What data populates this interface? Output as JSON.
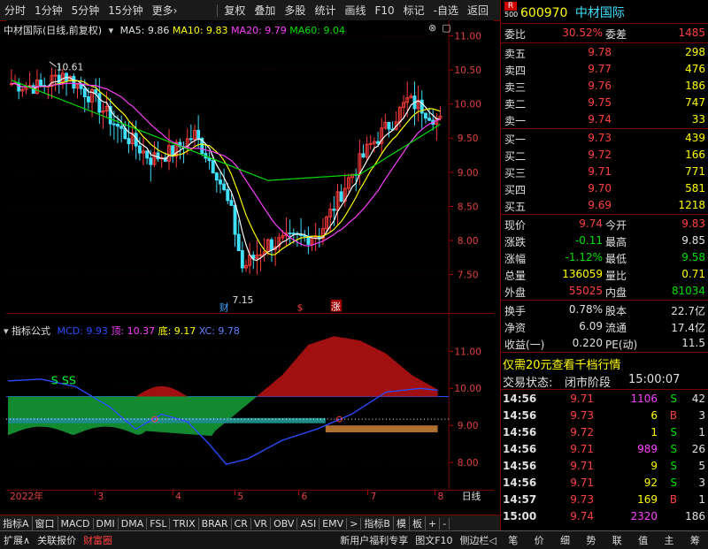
{
  "toolbar": {
    "periods": [
      "分时",
      "1分钟",
      "5分钟",
      "15分钟",
      "更多›"
    ],
    "actions": [
      "复权",
      "叠加",
      "多股",
      "统计",
      "画线",
      "F10",
      "标记",
      "-自选",
      "返回"
    ]
  },
  "main_legend": {
    "title": "中材国际(日线,前复权)",
    "ma5": "MA5: 9.86",
    "ma10": "MA10: 9.83",
    "ma20": "MA20: 9.79",
    "ma60": "MA60: 9.04"
  },
  "main_axis": [
    "11.00",
    "10.50",
    "10.00",
    "9.50",
    "9.00",
    "8.50",
    "8.00",
    "7.50"
  ],
  "annotations": {
    "high": "10.61",
    "low": "7.15",
    "cai": "财",
    "s1": "$",
    "zhang": "涨"
  },
  "indicator_legend": {
    "title": "指标公式",
    "mcd": "MCD: 9.93",
    "ding": "顶: 10.37",
    "di": "底: 9.17",
    "xc": "XC: 9.78",
    "ss": "S  SS"
  },
  "indicator_axis": [
    "11.00",
    "10.00",
    "9.00",
    "8.00"
  ],
  "x_axis": {
    "year": "2022年",
    "months": [
      "3",
      "4",
      "5",
      "6",
      "7",
      "8"
    ],
    "period_label": "日线"
  },
  "bottom_tabs": [
    "指标A",
    "窗口",
    "MACD",
    "DMI",
    "DMA",
    "FSL",
    "TRIX",
    "BRAR",
    "CR",
    "VR",
    "OBV",
    "ASI",
    "EMV",
    ">",
    "指标B",
    "模",
    "板",
    "+",
    "-"
  ],
  "status_bar": {
    "left": [
      "扩展∧",
      "关联报价",
      "财富圈"
    ],
    "promo": "新用户福利专享",
    "mid": [
      "图文F10",
      "侧边栏◁"
    ],
    "right": [
      "笔",
      "价",
      "细",
      "势",
      "联",
      "值",
      "主",
      "筹"
    ]
  },
  "quote": {
    "badge": "R",
    "code_num": "500",
    "code": "600970",
    "name": "中材国际",
    "weibi_label": "委比",
    "weibi": "30.52%",
    "weicha_label": "委差",
    "weicha": "1485",
    "asks": [
      {
        "label": "卖五",
        "price": "9.78",
        "vol": "298"
      },
      {
        "label": "卖四",
        "price": "9.77",
        "vol": "476"
      },
      {
        "label": "卖三",
        "price": "9.76",
        "vol": "186"
      },
      {
        "label": "卖二",
        "price": "9.75",
        "vol": "747"
      },
      {
        "label": "卖一",
        "price": "9.74",
        "vol": "33"
      }
    ],
    "bids": [
      {
        "label": "买一",
        "price": "9.73",
        "vol": "439"
      },
      {
        "label": "买二",
        "price": "9.72",
        "vol": "166"
      },
      {
        "label": "买三",
        "price": "9.71",
        "vol": "771"
      },
      {
        "label": "买四",
        "price": "9.70",
        "vol": "581"
      },
      {
        "label": "买五",
        "price": "9.69",
        "vol": "1218"
      }
    ],
    "stats": [
      {
        "l1": "现价",
        "v1": "9.74",
        "c1": "red",
        "l2": "今开",
        "v2": "9.83",
        "c2": "red"
      },
      {
        "l1": "涨跌",
        "v1": "-0.11",
        "c1": "grn",
        "l2": "最高",
        "v2": "9.85",
        "c2": "wht"
      },
      {
        "l1": "涨幅",
        "v1": "-1.12%",
        "c1": "grn",
        "l2": "最低",
        "v2": "9.58",
        "c2": "grn"
      },
      {
        "l1": "总量",
        "v1": "136059",
        "c1": "yel",
        "l2": "量比",
        "v2": "0.71",
        "c2": "yel"
      },
      {
        "l1": "外盘",
        "v1": "55025",
        "c1": "red",
        "l2": "内盘",
        "v2": "81034",
        "c2": "grn"
      }
    ],
    "stats2": [
      {
        "l1": "换手",
        "v1": "0.78%",
        "l2": "股本",
        "v2": "22.7亿"
      },
      {
        "l1": "净资",
        "v1": "6.09",
        "l2": "流通",
        "v2": "17.4亿"
      },
      {
        "l1": "收益(一)",
        "v1": "0.220",
        "l2": "PE(动)",
        "v2": "11.5"
      }
    ],
    "promo": "仅需20元查看千档行情",
    "trade_status_label": "交易状态:",
    "trade_status": "闭市阶段",
    "trade_time": "15:00:07",
    "ticks": [
      {
        "t": "14:56",
        "p": "9.71",
        "v": "1106",
        "s": "S",
        "n": "42",
        "vc": "mag"
      },
      {
        "t": "14:56",
        "p": "9.73",
        "v": "6",
        "s": "B",
        "n": "3",
        "vc": "yel"
      },
      {
        "t": "14:56",
        "p": "9.72",
        "v": "1",
        "s": "S",
        "n": "1",
        "vc": "yel"
      },
      {
        "t": "14:56",
        "p": "9.71",
        "v": "989",
        "s": "S",
        "n": "26",
        "vc": "mag"
      },
      {
        "t": "14:56",
        "p": "9.71",
        "v": "9",
        "s": "S",
        "n": "5",
        "vc": "yel"
      },
      {
        "t": "14:56",
        "p": "9.71",
        "v": "92",
        "s": "S",
        "n": "3",
        "vc": "yel"
      },
      {
        "t": "14:57",
        "p": "9.73",
        "v": "169",
        "s": "B",
        "n": "1",
        "vc": "yel"
      },
      {
        "t": "15:00",
        "p": "9.74",
        "v": "2320",
        "s": "",
        "n": "186",
        "vc": "mag"
      }
    ]
  },
  "colors": {
    "up": "#ff3c3c",
    "down": "#40e0ff",
    "ma5": "#ffffff",
    "ma10": "#ffff00",
    "ma20": "#ff40ff",
    "ma60": "#00e000",
    "mcd": "#2a4cff"
  }
}
